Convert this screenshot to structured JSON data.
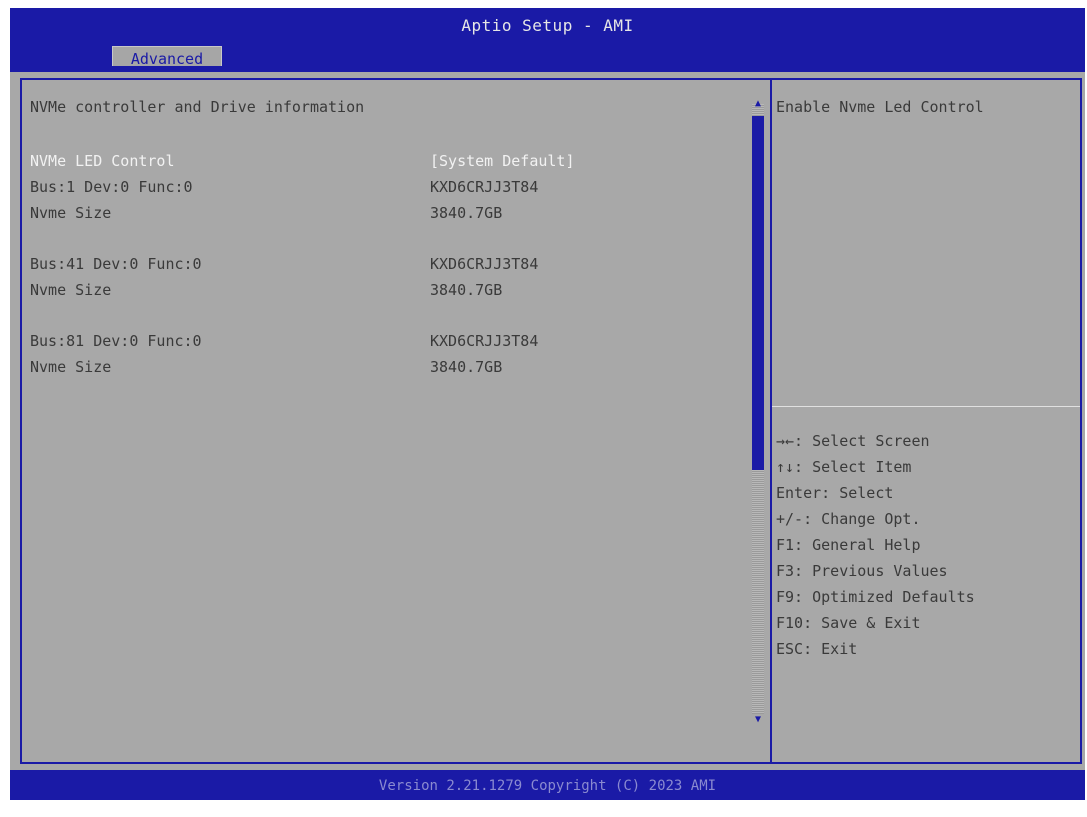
{
  "header": {
    "title": "Aptio Setup - AMI",
    "tabs": [
      {
        "label": "Advanced",
        "selected": true
      }
    ]
  },
  "content": {
    "heading": "NVMe controller and Drive information",
    "selected_item": {
      "label": "NVMe LED Control",
      "value": "[System Default]"
    },
    "devices": [
      {
        "bus_label": "Bus:1 Dev:0 Func:0",
        "model": "KXD6CRJJ3T84",
        "size_label": "Nvme Size",
        "size": "3840.7GB"
      },
      {
        "bus_label": "Bus:41 Dev:0 Func:0",
        "model": "KXD6CRJJ3T84",
        "size_label": "Nvme Size",
        "size": "3840.7GB"
      },
      {
        "bus_label": "Bus:81 Dev:0 Func:0",
        "model": "KXD6CRJJ3T84",
        "size_label": "Nvme Size",
        "size": "3840.7GB"
      }
    ]
  },
  "help": {
    "description": "Enable Nvme Led Control",
    "keys": [
      "→←: Select Screen",
      "↑↓: Select Item",
      "Enter: Select",
      "+/-: Change Opt.",
      "F1: General Help",
      "F3: Previous Values",
      "F9: Optimized Defaults",
      "F10: Save & Exit",
      "ESC: Exit"
    ]
  },
  "footer": {
    "text": "Version 2.21.1279 Copyright (C) 2023 AMI"
  },
  "colors": {
    "bar_blue": "#1a1aa6",
    "panel_gray": "#a8a8a8",
    "selected_text": "#f2f2f2",
    "normal_text": "#3a3a3a"
  }
}
